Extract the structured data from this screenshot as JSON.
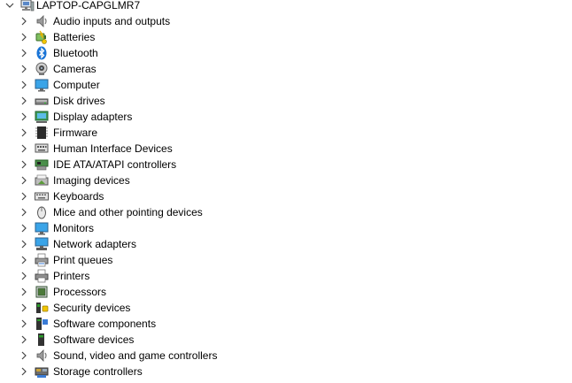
{
  "tree": {
    "root": {
      "label": "LAPTOP-CAPGLMR7",
      "icon": "computer-root-icon",
      "expanded": true
    },
    "categories": [
      {
        "label": "Audio inputs and outputs",
        "icon": "speaker-icon"
      },
      {
        "label": "Batteries",
        "icon": "battery-icon"
      },
      {
        "label": "Bluetooth",
        "icon": "bluetooth-icon"
      },
      {
        "label": "Cameras",
        "icon": "camera-icon"
      },
      {
        "label": "Computer",
        "icon": "monitor-icon"
      },
      {
        "label": "Disk drives",
        "icon": "disk-drive-icon"
      },
      {
        "label": "Display adapters",
        "icon": "display-adapter-icon"
      },
      {
        "label": "Firmware",
        "icon": "firmware-chip-icon"
      },
      {
        "label": "Human Interface Devices",
        "icon": "hid-icon"
      },
      {
        "label": "IDE ATA/ATAPI controllers",
        "icon": "ide-controller-icon"
      },
      {
        "label": "Imaging devices",
        "icon": "imaging-device-icon"
      },
      {
        "label": "Keyboards",
        "icon": "keyboard-icon"
      },
      {
        "label": "Mice and other pointing devices",
        "icon": "mouse-icon"
      },
      {
        "label": "Monitors",
        "icon": "monitor-icon"
      },
      {
        "label": "Network adapters",
        "icon": "network-adapter-icon"
      },
      {
        "label": "Print queues",
        "icon": "print-queue-icon"
      },
      {
        "label": "Printers",
        "icon": "printer-icon"
      },
      {
        "label": "Processors",
        "icon": "processor-icon"
      },
      {
        "label": "Security devices",
        "icon": "security-device-icon"
      },
      {
        "label": "Software components",
        "icon": "software-component-icon"
      },
      {
        "label": "Software devices",
        "icon": "software-device-icon"
      },
      {
        "label": "Sound, video and game controllers",
        "icon": "speaker-icon"
      },
      {
        "label": "Storage controllers",
        "icon": "storage-controller-icon"
      }
    ]
  }
}
